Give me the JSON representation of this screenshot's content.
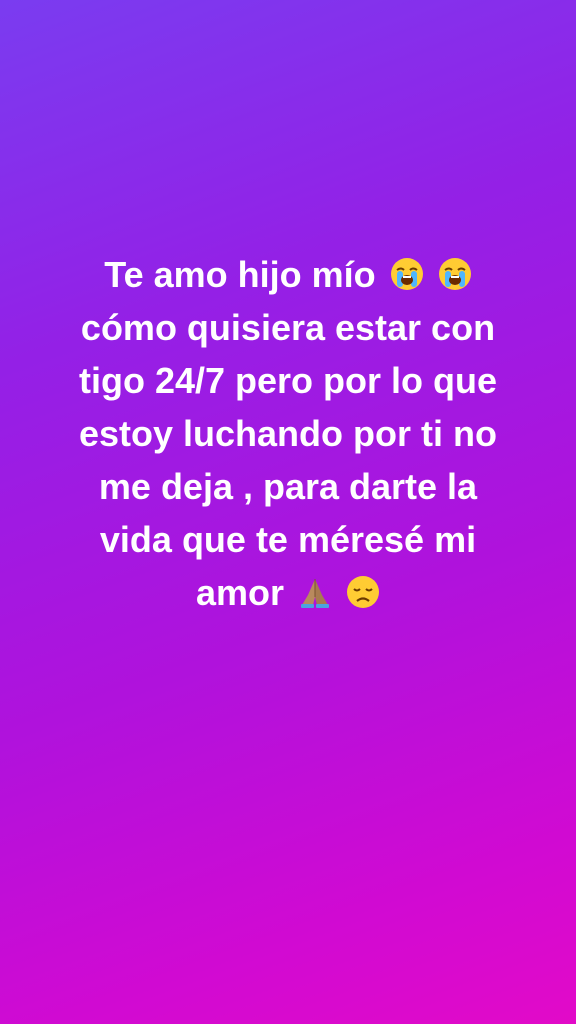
{
  "story": {
    "lines": [
      "Te amo hijo mío",
      "cómo quisiera estar con",
      "tigo 24/7 pero por lo que",
      "estoy luchando por ti no",
      "me deja , para darte la",
      "vida que te méresé mi",
      "amor"
    ],
    "emojis": {
      "line1": [
        "loudly-crying-face-icon",
        "loudly-crying-face-icon"
      ],
      "line7": [
        "folded-hands-icon",
        "disappointed-face-icon"
      ]
    },
    "colors": {
      "gradient_start": "#7a3cf0",
      "gradient_end": "#e20ac8",
      "text": "#ffffff"
    }
  }
}
